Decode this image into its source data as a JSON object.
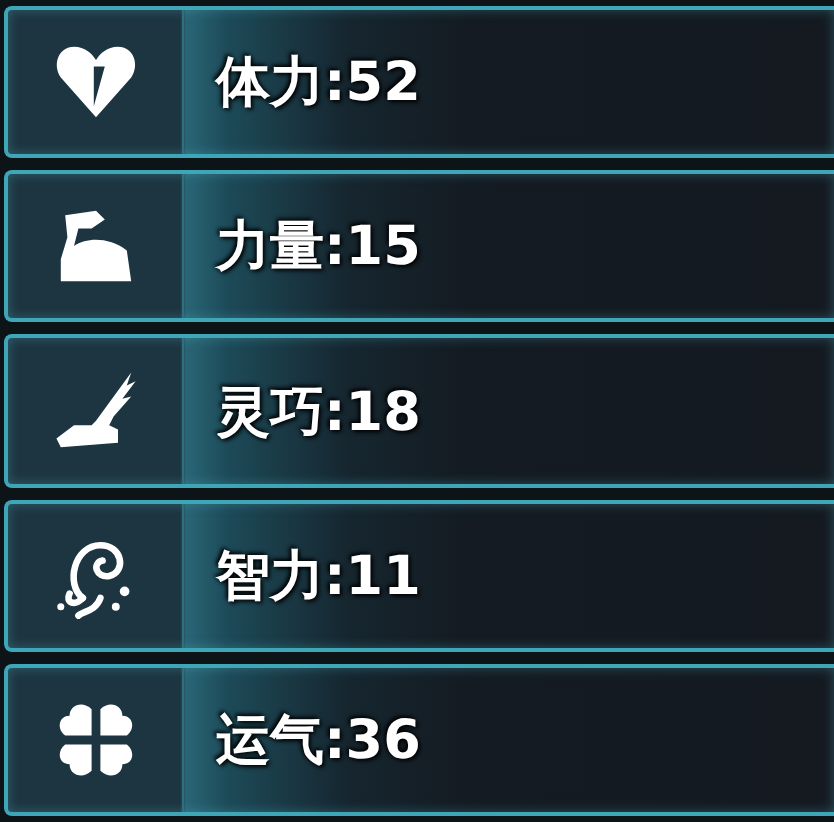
{
  "stats": [
    {
      "kind": "heart",
      "text": "体力:52"
    },
    {
      "kind": "arm",
      "text": "力量:15"
    },
    {
      "kind": "wing",
      "text": "灵巧:18"
    },
    {
      "kind": "swirl",
      "text": "智力:11"
    },
    {
      "kind": "clover",
      "text": "运气:36"
    }
  ]
}
